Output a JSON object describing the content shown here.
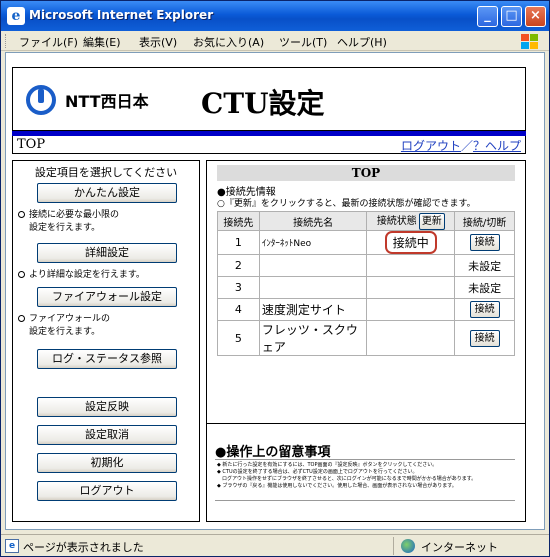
{
  "window": {
    "title": "Microsoft Internet Explorer",
    "icon": "ie-icon"
  },
  "menu": [
    "ファイル(F)",
    "編集(E)",
    "表示(V)",
    "お気に入り(A)",
    "ツール(T)",
    "ヘルプ(H)"
  ],
  "header": {
    "brand": "NTT西日本",
    "title": "CTU設定"
  },
  "topbar": {
    "label": "TOP",
    "logout": "ログアウト",
    "sep": "／",
    "help": "？ヘルプ"
  },
  "left": {
    "heading": "設定項目を選択してください",
    "buttons": {
      "easy": "かんたん設定",
      "detail": "詳細設定",
      "firewall": "ファイアウォール設定",
      "log": "ログ・ステータス参照",
      "apply": "設定反映",
      "cancel": "設定取消",
      "init": "初期化",
      "logout": "ログアウト"
    },
    "desc": {
      "easy_1": "接続に必要な最小限の",
      "easy_2": "設定を行えます。",
      "detail": "より詳細な設定を行えます。",
      "fw_1": "ファイアウォールの",
      "fw_2": "設定を行えます。"
    }
  },
  "right": {
    "heading": "TOP",
    "conn_info": "●接続先情報",
    "conn_note": "○『更新』をクリックすると、最新の接続状態が確認できます。",
    "table": {
      "headers": {
        "no": "接続先",
        "name": "接続先名",
        "status": "接続状態",
        "refresh": "更新",
        "action": "接続/切断"
      },
      "rows": [
        {
          "no": "1",
          "name": "ｲﾝﾀｰﾈｯﾄNeo",
          "status": "接続中",
          "action": "接続"
        },
        {
          "no": "2",
          "name": "",
          "status": "",
          "action": "未設定"
        },
        {
          "no": "3",
          "name": "",
          "status": "",
          "action": "未設定"
        },
        {
          "no": "4",
          "name": "速度測定サイト",
          "status": "",
          "action": "接続"
        },
        {
          "no": "5",
          "name": "フレッツ・スクウェア",
          "status": "",
          "action": "接続"
        }
      ]
    },
    "notes_title": "●操作上の留意事項",
    "notes": [
      "◆ 新たに行った設定を有効にするには、TOP画面の『設定反映』ボタンをクリックしてください。",
      "◆ CTUの設定を終了する場合は、必ずCTU設定の画面上でログアウトを行ってください。",
      "　ログアウト操作をせずにブラウザを終了させると、次にログインが可能になるまで時間がかかる場合があります。",
      "◆ ブラウザの『戻る』機能は使用しないでください。使用した場合、画面が表示されない場合があります。"
    ]
  },
  "statusbar": {
    "text": "ページが表示されました",
    "zone": "インターネット"
  }
}
